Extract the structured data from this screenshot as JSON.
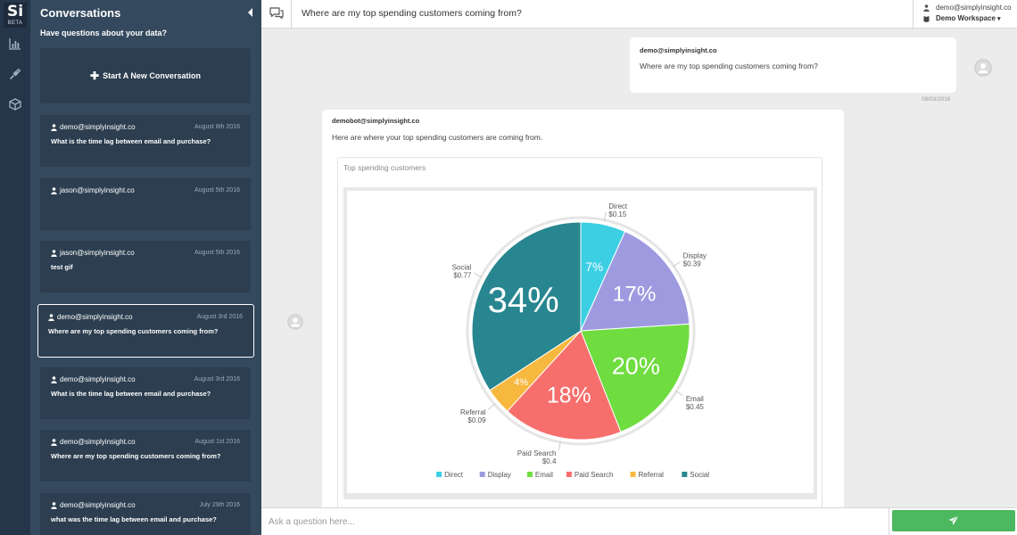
{
  "app": {
    "logo_text": "Si",
    "logo_badge": "BETA"
  },
  "rail": {
    "icons": [
      "bar-chart-icon",
      "plug-icon",
      "cube-icon"
    ]
  },
  "panel": {
    "title": "Conversations",
    "subtitle": "Have questions about your data?",
    "new_button": "Start A New Conversation",
    "conversations": [
      {
        "user": "demo@simplyinsight.co",
        "date": "August 8th 2016",
        "question": "What is the time lag between email and purchase?",
        "active": false
      },
      {
        "user": "jason@simplyinsight.co",
        "date": "August 5th 2016",
        "question": "",
        "active": false
      },
      {
        "user": "jason@simplyinsight.co",
        "date": "August 5th 2016",
        "question": "test gif",
        "active": false
      },
      {
        "user": "demo@simplyinsight.co",
        "date": "August 3rd 2016",
        "question": "Where are my top spending customers coming from?",
        "active": true
      },
      {
        "user": "demo@simplyinsight.co",
        "date": "August 3rd 2016",
        "question": "What is the time lag between email and purchase?",
        "active": false
      },
      {
        "user": "demo@simplyinsight.co",
        "date": "August 1st 2016",
        "question": "Where are my top spending customers coming from?",
        "active": false
      },
      {
        "user": "demo@simplyinsight.co",
        "date": "July 29th 2016",
        "question": "what was the time lag between email and purchase?",
        "active": false
      }
    ]
  },
  "header": {
    "title": "Where are my top spending customers coming from?",
    "account_email": "demo@simplyinsight.co",
    "workspace": "Demo Workspace"
  },
  "messages": {
    "user": {
      "sender": "demo@simplyinsight.co",
      "text": "Where are my top spending customers coming from?",
      "time": "08/03/2016"
    },
    "bot": {
      "sender": "demobot@simplyinsight.co",
      "text": "Here are where your top spending customers are coming from."
    }
  },
  "input": {
    "placeholder": "Ask a question here...",
    "value": ""
  },
  "colors": {
    "accent": "#4cb85f",
    "panel": "#34495e",
    "card": "#2c3e50",
    "rail": "#26364a"
  },
  "chart_data": {
    "type": "pie",
    "title": "Top spending customers",
    "series": [
      {
        "name": "Direct",
        "value": 0.15,
        "label": "$0.15",
        "percent_label": "7%",
        "color": "#3ccfe4"
      },
      {
        "name": "Display",
        "value": 0.39,
        "label": "$0.39",
        "percent_label": "17%",
        "color": "#9e9ae0"
      },
      {
        "name": "Email",
        "value": 0.45,
        "label": "$0.45",
        "percent_label": "20%",
        "color": "#6fdc40"
      },
      {
        "name": "Paid Search",
        "value": 0.4,
        "label": "$0.4",
        "percent_label": "18%",
        "color": "#f76f6c"
      },
      {
        "name": "Referral",
        "value": 0.09,
        "label": "$0.09",
        "percent_label": "4%",
        "color": "#f7b840"
      },
      {
        "name": "Social",
        "value": 0.77,
        "label": "$0.77",
        "percent_label": "34%",
        "color": "#27868f"
      }
    ],
    "legend": "bottom"
  }
}
